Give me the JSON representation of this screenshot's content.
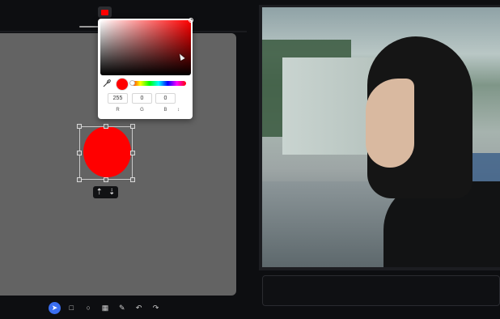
{
  "color_picker": {
    "current_color": "#ff0000",
    "hue_value": 0,
    "r_value": "255",
    "g_value": "0",
    "b_value": "0",
    "r_label": "R",
    "g_label": "G",
    "b_label": "B",
    "mode_toggle_label": "↕"
  },
  "shape": {
    "type": "circle",
    "fill_color": "#ff0000"
  },
  "shape_toolbar": {
    "move_up_icon": "⇡",
    "move_down_icon": "⇣"
  },
  "bottom_toolbar": {
    "items": [
      {
        "name": "select-tool",
        "glyph": "➤",
        "active": true
      },
      {
        "name": "rectangle-tool",
        "glyph": "□",
        "active": false
      },
      {
        "name": "circle-tool",
        "glyph": "○",
        "active": false
      },
      {
        "name": "image-tool",
        "glyph": "▦",
        "active": false
      },
      {
        "name": "pen-tool",
        "glyph": "✎",
        "active": false
      },
      {
        "name": "undo-button",
        "glyph": "↶",
        "active": false
      },
      {
        "name": "redo-button",
        "glyph": "↷",
        "active": false
      }
    ]
  },
  "colors": {
    "accent": "#3a6ef0",
    "canvas_bg": "#636363",
    "app_bg": "#0d0e11"
  }
}
